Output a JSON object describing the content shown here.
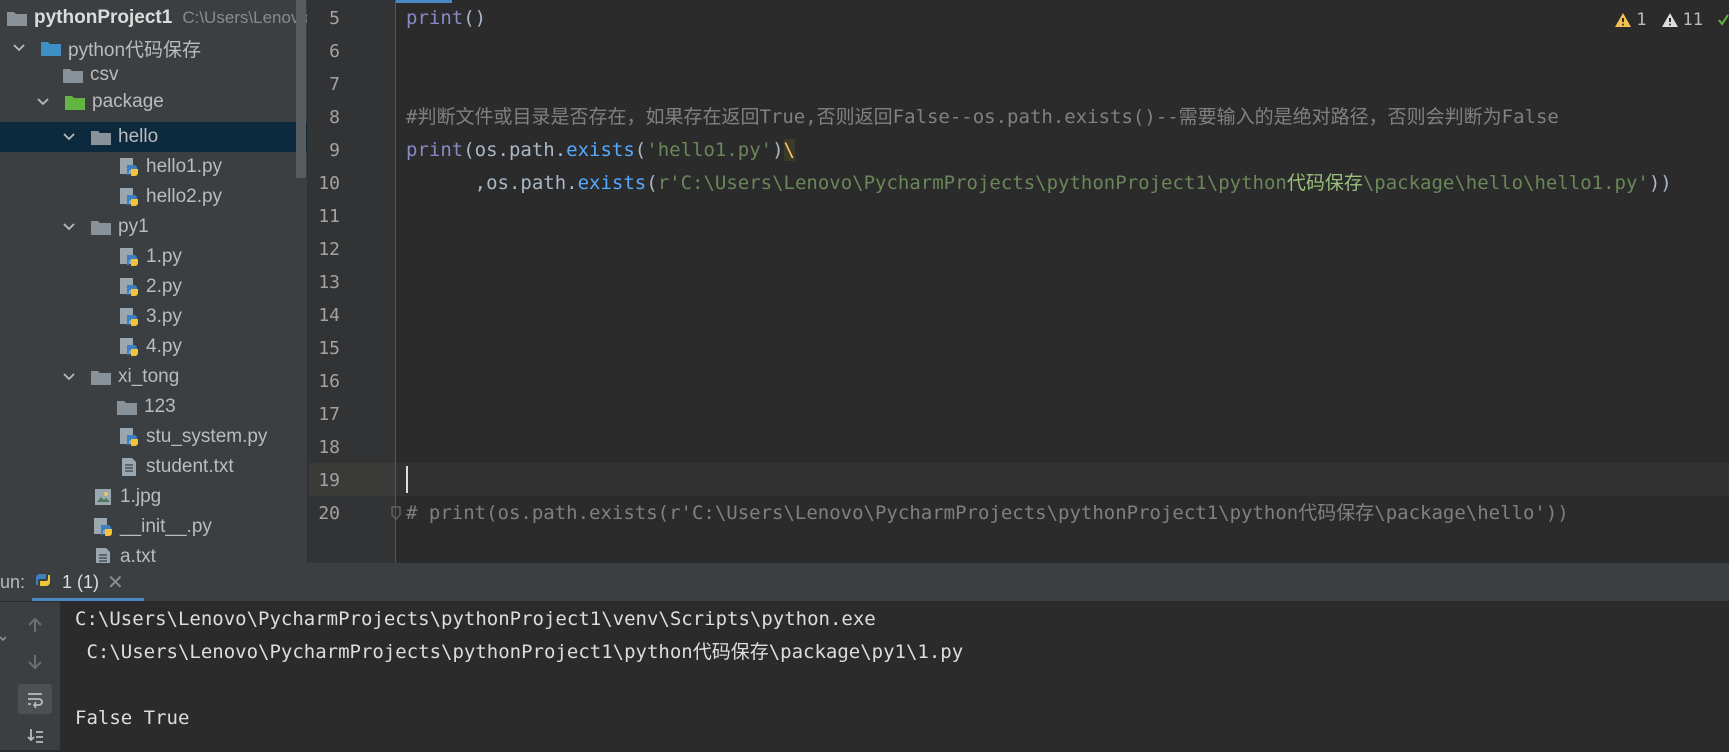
{
  "project": {
    "name": "pythonProject1",
    "path": "C:\\Users\\Lenovo",
    "items": [
      {
        "label": "python代码保存",
        "type": "folder",
        "color": "blue",
        "depth": 1,
        "expanded": true
      },
      {
        "label": "csv",
        "type": "folder",
        "color": "gray",
        "depth": 2
      },
      {
        "label": "package",
        "type": "folder",
        "color": "green",
        "depth": 2,
        "expanded": true
      },
      {
        "label": "hello",
        "type": "folder",
        "color": "gray",
        "depth": 3,
        "expanded": true,
        "selected": true
      },
      {
        "label": "hello1.py",
        "type": "python",
        "depth": 4
      },
      {
        "label": "hello2.py",
        "type": "python",
        "depth": 4
      },
      {
        "label": "py1",
        "type": "folder",
        "color": "gray",
        "depth": 3,
        "expanded": true
      },
      {
        "label": "1.py",
        "type": "python",
        "depth": 4
      },
      {
        "label": "2.py",
        "type": "python",
        "depth": 4
      },
      {
        "label": "3.py",
        "type": "python",
        "depth": 4
      },
      {
        "label": "4.py",
        "type": "python",
        "depth": 4
      },
      {
        "label": "xi_tong",
        "type": "folder",
        "color": "gray",
        "depth": 3,
        "expanded": true
      },
      {
        "label": "123",
        "type": "folder",
        "color": "gray",
        "depth": 4
      },
      {
        "label": "stu_system.py",
        "type": "python",
        "depth": 4
      },
      {
        "label": "student.txt",
        "type": "text",
        "depth": 4
      },
      {
        "label": "1.jpg",
        "type": "image",
        "depth": 3
      },
      {
        "label": "__init__.py",
        "type": "python",
        "depth": 3
      },
      {
        "label": "a.txt",
        "type": "text",
        "depth": 3
      }
    ]
  },
  "editor": {
    "warnings": {
      "count1": "1",
      "count2": "11"
    },
    "line_numbers": [
      "5",
      "6",
      "7",
      "8",
      "9",
      "10",
      "11",
      "12",
      "13",
      "14",
      "15",
      "16",
      "17",
      "18",
      "19",
      "20"
    ],
    "line5": {
      "fn": "print",
      "rest": "()"
    },
    "line8": {
      "p1": "#判断文件或目录是否存在，如果存在返回",
      "p2": "True",
      "p3": ",否则返回",
      "p4": "False--os.path.exists()--",
      "p5": "需要输入的是绝对路径，否则会判断为",
      "p6": "False"
    },
    "line9": {
      "fn": "print",
      "p1": "(os.path.",
      "method": "exists",
      "p2": "(",
      "str": "'hello1.py'",
      "p3": ")",
      "bs": "\\"
    },
    "line10": {
      "p1": "      ,os.path.",
      "method": "exists",
      "p2": "(",
      "str1": "r'C:\\Users\\Lenovo\\PycharmProjects\\pythonProject1\\python",
      "str_cn": "代码保存",
      "str2": "\\package\\hello\\hello1.py'",
      "p3": "))"
    },
    "line20": {
      "p1": "# print(os.path.exists(r'C:\\Users\\Lenovo\\PycharmProjects\\pythonProject1\\python",
      "p2": "代码保存",
      "p3": "\\package\\hello'))"
    }
  },
  "run": {
    "label": "un:",
    "tab_label": "1 (1)",
    "console_lines": [
      "C:\\Users\\Lenovo\\PycharmProjects\\pythonProject1\\venv\\Scripts\\python.exe",
      " C:\\Users\\Lenovo\\PycharmProjects\\pythonProject1\\python代码保存\\package\\py1\\1.py",
      "",
      "False True"
    ]
  }
}
